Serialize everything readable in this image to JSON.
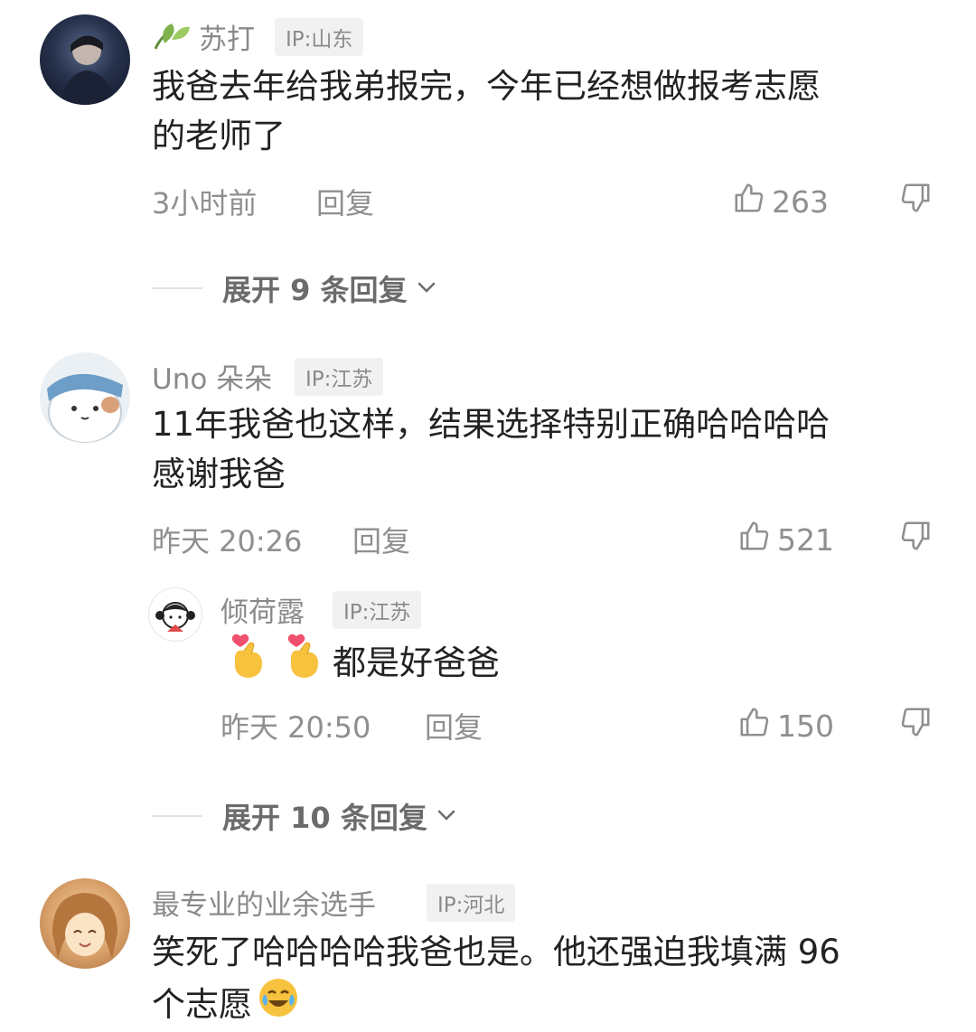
{
  "comments": [
    {
      "name": "苏打",
      "ip": "IP:山东",
      "text_lines": [
        "我爸去年给我弟报完，今年已经想做报考志愿",
        "的老师了"
      ],
      "time": "3小时前",
      "reply_label": "回复",
      "likes": "263",
      "expand_label": "展开 9 条回复"
    },
    {
      "name": "Uno 朵朵",
      "ip": "IP:江苏",
      "text_lines": [
        "11年我爸也这样，结果选择特别正确哈哈哈哈",
        "感谢我爸"
      ],
      "time": "昨天 20:26",
      "reply_label": "回复",
      "likes": "521",
      "sub_reply": {
        "name": "倾荷露",
        "ip": "IP:江苏",
        "text": "都是好爸爸",
        "time": "昨天 20:50",
        "reply_label": "回复",
        "likes": "150"
      },
      "expand_label": "展开 10 条回复"
    },
    {
      "name": "最专业的业余选手",
      "ip": "IP:河北",
      "text_lines": [
        "笑死了哈哈哈哈我爸也是。他还强迫我填满 96",
        "个志愿"
      ]
    }
  ],
  "icons": {
    "name_badge": "leaf-icon",
    "like": "thumbs-up-icon",
    "dislike": "thumbs-down-icon",
    "expand": "chevron-down-icon",
    "heart_hand": "finger-heart-emoji-icon",
    "cry_laugh": "crying-laughing-emoji-icon"
  },
  "colors": {
    "text": "#222222",
    "meta": "#8f8f8f",
    "ip_bg": "#f1f1f1"
  }
}
